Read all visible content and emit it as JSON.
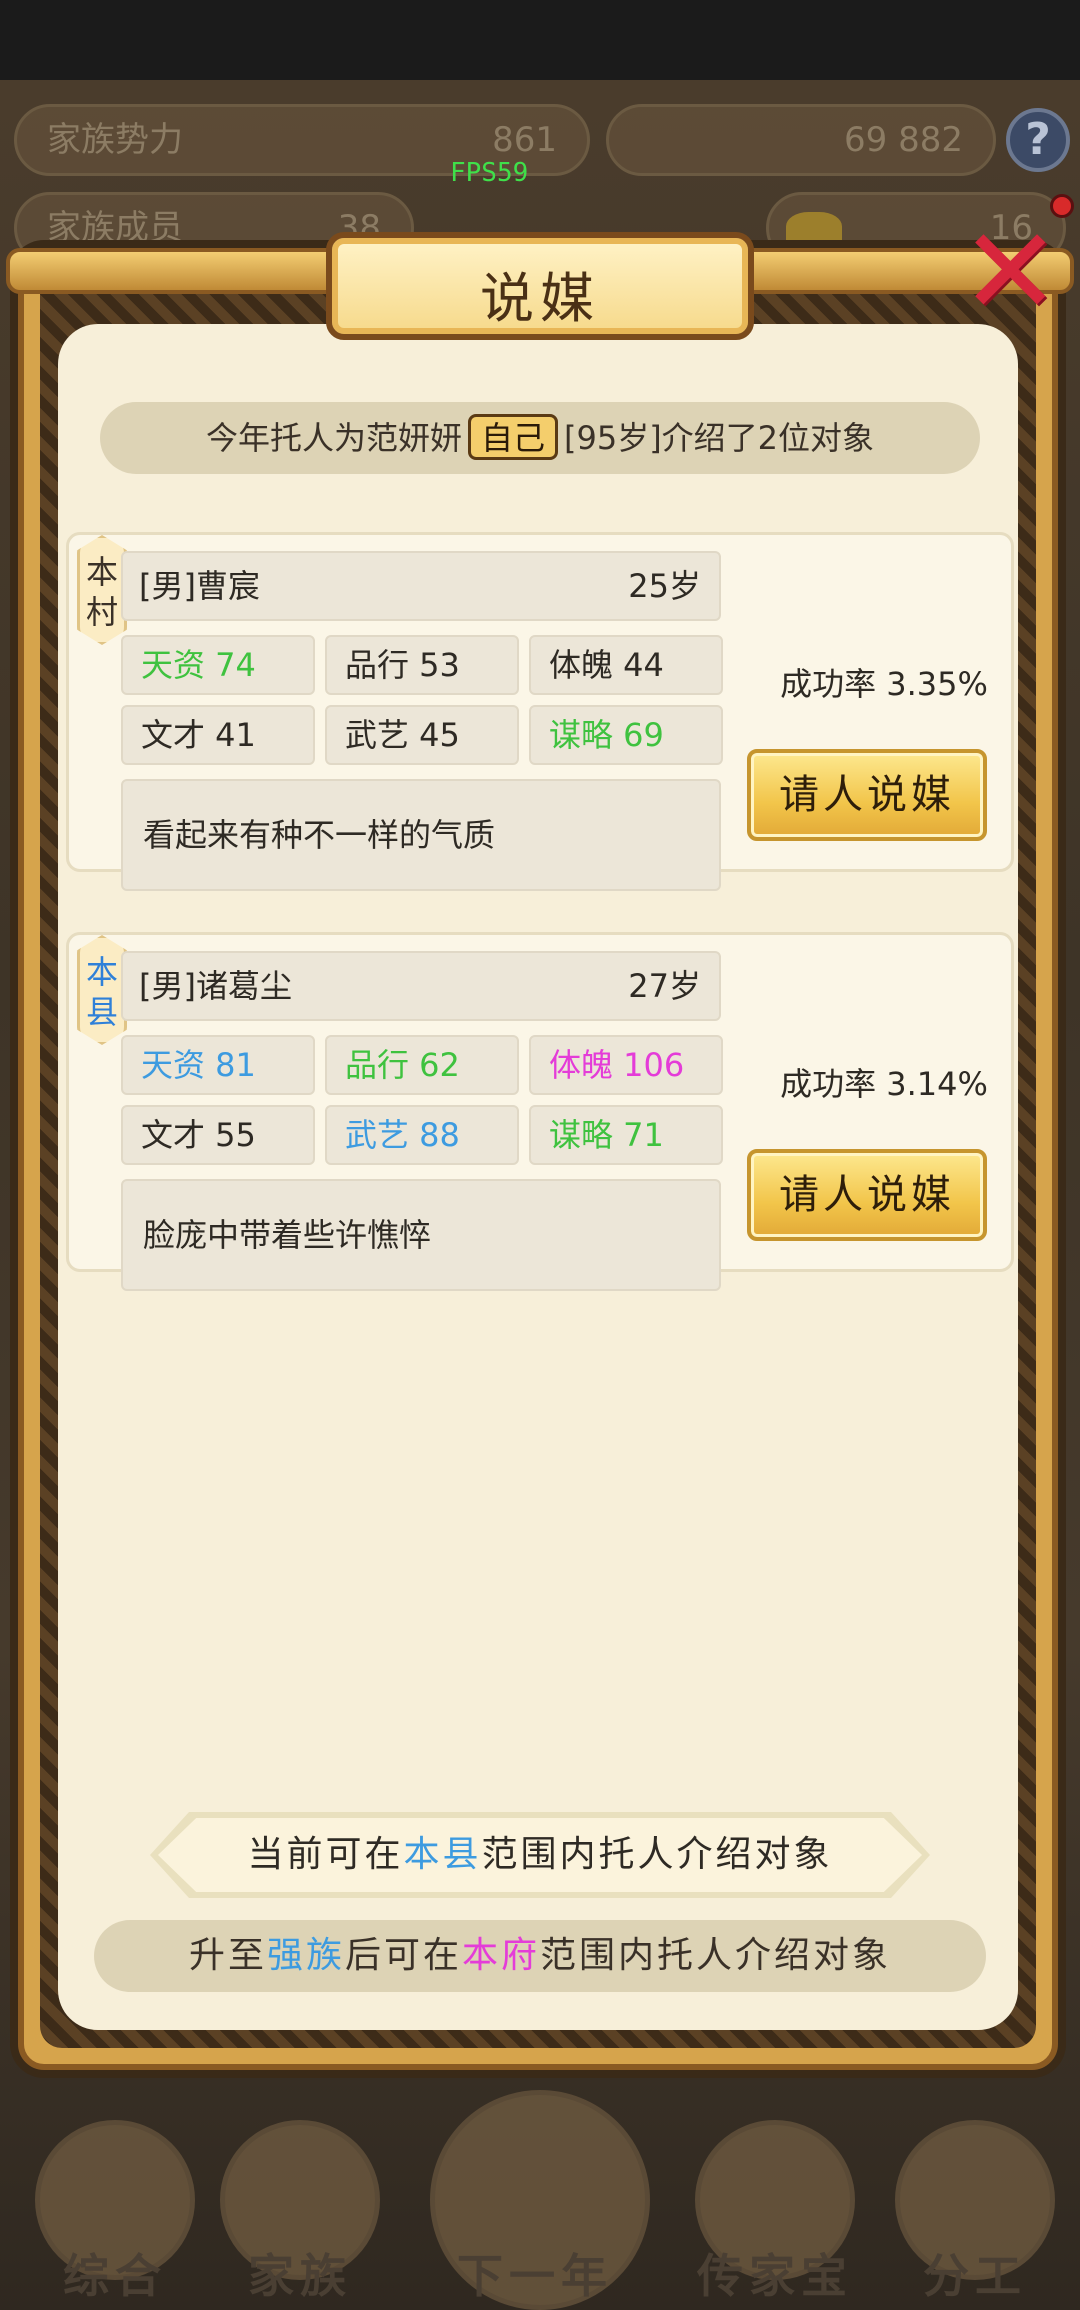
{
  "background": {
    "stats": [
      {
        "label": "家族势力",
        "value": "861"
      },
      {
        "label": "",
        "value": "69  882"
      },
      {
        "label": "家族成员",
        "value": "38"
      },
      {
        "label": "",
        "value": "16"
      }
    ],
    "fps": "FPS59",
    "help": "?",
    "nav": [
      "综合",
      "家族",
      "下一年",
      "传家宝",
      "分工"
    ]
  },
  "modal": {
    "title": "说媒",
    "close": "✕",
    "summary_before": "今年托人为范妍妍",
    "summary_badge": "自己",
    "summary_after": "[95岁]介绍了2位对象",
    "candidates": [
      {
        "scope": "本村",
        "name": "[男]曹宸",
        "age": "25岁",
        "attributes": [
          {
            "text": "天资 74",
            "color": "green"
          },
          {
            "text": "品行 53",
            "color": "black"
          },
          {
            "text": "体魄 44",
            "color": "black"
          },
          {
            "text": "文才 41",
            "color": "black"
          },
          {
            "text": "武艺 45",
            "color": "black"
          },
          {
            "text": "谋略 69",
            "color": "green"
          }
        ],
        "description": "看起来有种不一样的气质",
        "success_rate": "成功率 3.35%",
        "button": "请人说媒"
      },
      {
        "scope": "本县",
        "name": "[男]诸葛尘",
        "age": "27岁",
        "attributes": [
          {
            "text": "天资 81",
            "color": "blue"
          },
          {
            "text": "品行 62",
            "color": "green"
          },
          {
            "text": "体魄 106",
            "color": "magenta"
          },
          {
            "text": "文才 55",
            "color": "black"
          },
          {
            "text": "武艺 88",
            "color": "blue"
          },
          {
            "text": "谋略 71",
            "color": "green"
          }
        ],
        "description": "脸庞中带着些许憔悴",
        "success_rate": "成功率 3.14%",
        "button": "请人说媒"
      }
    ],
    "notice": {
      "before": "当前可在",
      "highlight": "本县",
      "after": "范围内托人介绍对象"
    },
    "upgrade": {
      "p1": "升至",
      "h1": "强族",
      "p2": "后可在",
      "h2": "本府",
      "p3": "范围内托人介绍对象"
    }
  },
  "colors": {
    "green": "#3fc23f",
    "blue": "#3d9be0",
    "magenta": "#e43cd8",
    "black": "#2e2a24"
  }
}
